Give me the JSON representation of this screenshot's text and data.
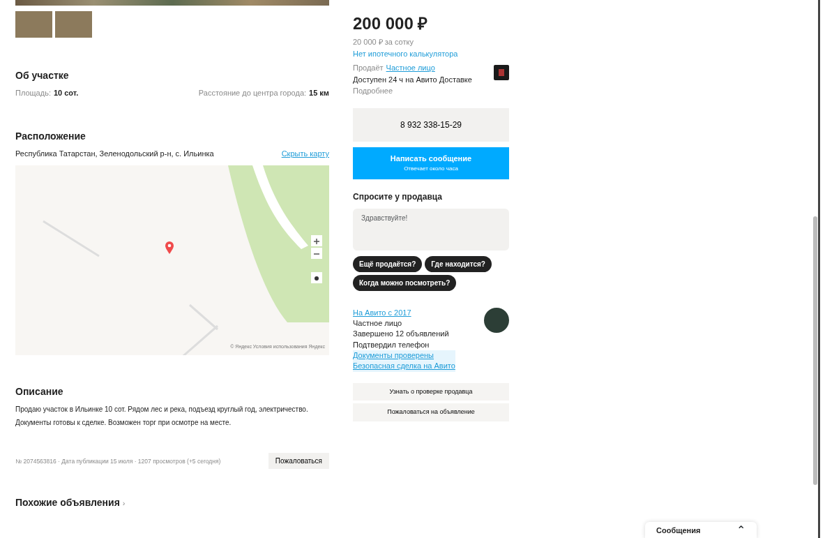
{
  "about": {
    "title": "Об участке",
    "params": [
      {
        "label": "Площадь:",
        "value": "10 сот."
      },
      {
        "label": "Расстояние до центра города:",
        "value": "15 км"
      }
    ]
  },
  "location": {
    "title": "Расположение",
    "address": "Республика Татарстан, Зеленодольский р-н, с. Ильинка",
    "map_link": "Скрыть карту",
    "map_attribution": "© Яндекс Условия использования Яндекс"
  },
  "description": {
    "title": "Описание",
    "text": "Продаю участок в Ильинке 10 сот. Рядом лес и река, подъезд круглый год, электричество. Документы готовы к сделке. Возможен торг при осмотре на месте."
  },
  "footer": {
    "meta": "№ 2074563816 · Дата публикации 15 июля · 1207 просмотров (+5 сегодня)",
    "report": "Пожаловаться"
  },
  "similar": {
    "title": "Похожие объявления",
    "arrow": "›"
  },
  "price": {
    "value": "200 000 ₽",
    "per_unit": "20 000 ₽ за сотку",
    "mortgage": "Нет ипотечного калькулятора"
  },
  "delivery": {
    "label": "Продаёт",
    "link": "Частное лицо",
    "line": "Доступен 24 ч на Авито Доставке",
    "sub": "Подробнее"
  },
  "phone": "8 932 338-15-29",
  "message": {
    "title": "Написать сообщение",
    "sub": "Отвечает около часа"
  },
  "ask": {
    "title": "Спросите у продавца",
    "placeholder": "Здравствуйте!",
    "chips": [
      "Ещё продаётся?",
      "Где находится?",
      "Когда можно посмотреть?"
    ]
  },
  "seller": {
    "link": "На Авито с 2017",
    "lines": [
      "Частное лицо",
      "Завершено 12 объявлений",
      "Подтвердил телефон"
    ],
    "links": [
      "Документы проверены",
      "Безопасная сделка на Авито"
    ]
  },
  "actions": [
    "Узнать о проверке продавца",
    "Пожаловаться на объявление"
  ],
  "messenger": {
    "label": "Сообщения",
    "chevron": "⌃"
  }
}
